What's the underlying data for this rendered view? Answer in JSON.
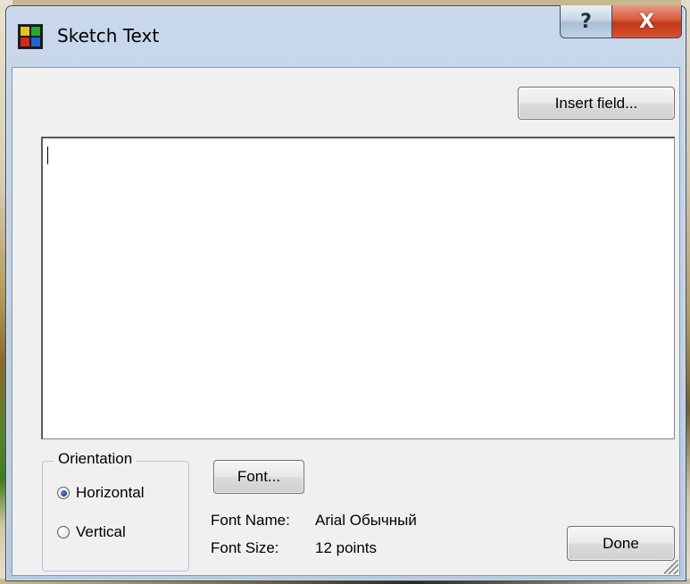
{
  "window": {
    "title": "Sketch Text",
    "help_label": "?",
    "close_label": "X"
  },
  "toolbar": {
    "insert_field_label": "Insert field..."
  },
  "text_editor": {
    "value": ""
  },
  "orientation": {
    "legend": "Orientation",
    "options": [
      {
        "label": "Horizontal",
        "checked": true
      },
      {
        "label": "Vertical",
        "checked": false
      }
    ]
  },
  "font": {
    "button_label": "Font...",
    "name_label": "Font Name:",
    "name_value": "Arial Обычный",
    "size_label": "Font Size:",
    "size_value": "12 points"
  },
  "actions": {
    "done_label": "Done"
  },
  "colors": {
    "close_button": "#d04a2b",
    "dialog_bg": "#f0f0f0",
    "titlebar": "#c9d8ea"
  }
}
